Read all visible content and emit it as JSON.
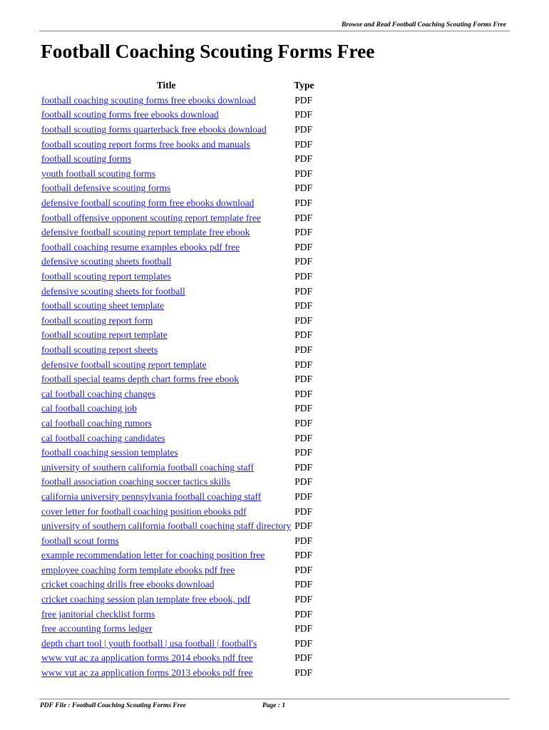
{
  "header": {
    "text": "Browse and Read Football Coaching Scouting Forms Free"
  },
  "page_title": "Football Coaching Scouting Forms Free",
  "table": {
    "columns": {
      "title": "Title",
      "type": "Type"
    },
    "rows": [
      {
        "title": "football coaching scouting forms free ebooks download",
        "type": "PDF"
      },
      {
        "title": "football scouting forms free ebooks download",
        "type": "PDF"
      },
      {
        "title": "football scouting forms quarterback free ebooks download",
        "type": "PDF"
      },
      {
        "title": "football scouting report forms free books and manuals",
        "type": "PDF"
      },
      {
        "title": "football scouting forms",
        "type": "PDF"
      },
      {
        "title": "youth football scouting forms",
        "type": "PDF"
      },
      {
        "title": "football defensive scouting forms",
        "type": "PDF"
      },
      {
        "title": "defensive football scouting form free ebooks download",
        "type": "PDF"
      },
      {
        "title": "football offensive opponent scouting report template free",
        "type": "PDF"
      },
      {
        "title": "defensive football scouting report template free ebook",
        "type": "PDF"
      },
      {
        "title": "football coaching resume examples ebooks pdf free",
        "type": "PDF"
      },
      {
        "title": "defensive scouting sheets football",
        "type": "PDF"
      },
      {
        "title": "football scouting report templates",
        "type": "PDF"
      },
      {
        "title": "defensive scouting sheets for football",
        "type": "PDF"
      },
      {
        "title": "football scouting sheet template",
        "type": "PDF"
      },
      {
        "title": "football scouting report form",
        "type": "PDF"
      },
      {
        "title": "football scouting report template",
        "type": "PDF"
      },
      {
        "title": "football scouting report sheets",
        "type": "PDF"
      },
      {
        "title": "defensive football scouting report template",
        "type": "PDF"
      },
      {
        "title": "football special teams depth chart forms free ebook",
        "type": "PDF"
      },
      {
        "title": "cal football coaching changes",
        "type": "PDF"
      },
      {
        "title": "cal football coaching job",
        "type": "PDF"
      },
      {
        "title": "cal football coaching rumors",
        "type": "PDF"
      },
      {
        "title": "cal football coaching candidates",
        "type": "PDF"
      },
      {
        "title": "football coaching session templates",
        "type": "PDF"
      },
      {
        "title": "university of southern california football coaching staff",
        "type": "PDF"
      },
      {
        "title": "football association coaching soccer tactics skills",
        "type": "PDF"
      },
      {
        "title": "california university pennsylvania football coaching staff",
        "type": "PDF"
      },
      {
        "title": "cover letter for football coaching position ebooks pdf",
        "type": "PDF"
      },
      {
        "title": "university of southern california football coaching staff directory",
        "type": "PDF"
      },
      {
        "title": "football scout forms",
        "type": "PDF"
      },
      {
        "title": "example recommendation letter for coaching position free",
        "type": "PDF"
      },
      {
        "title": "employee coaching form template ebooks pdf free",
        "type": "PDF"
      },
      {
        "title": "cricket coaching drills free ebooks download",
        "type": "PDF"
      },
      {
        "title": "cricket coaching session plan template free ebook, pdf",
        "type": "PDF"
      },
      {
        "title": "free janitorial checklist forms",
        "type": "PDF"
      },
      {
        "title": "free accounting forms ledger",
        "type": "PDF"
      },
      {
        "title": "depth chart tool | youth football | usa football | football's",
        "type": "PDF"
      },
      {
        "title": "www vut ac za application forms 2014 ebooks pdf free",
        "type": "PDF"
      },
      {
        "title": "www vut ac za application forms 2013 ebooks pdf free",
        "type": "PDF"
      }
    ]
  },
  "footer": {
    "file_label": "PDF File : Football Coaching Scouting Forms Free",
    "page_label": "Page : 1"
  },
  "colors": {
    "link": "#1a1aff",
    "rule": "#888888",
    "text": "#000000"
  }
}
